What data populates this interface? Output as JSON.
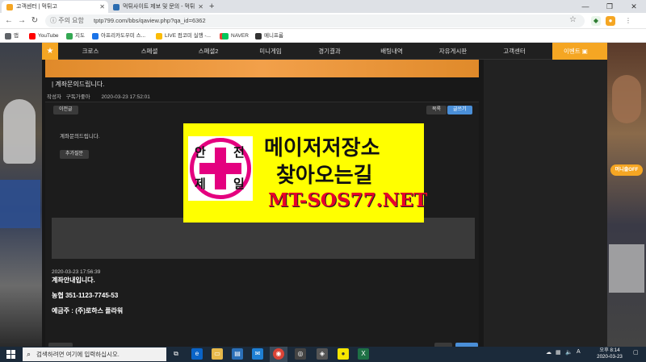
{
  "browser": {
    "tabs": [
      {
        "title": "고객센터 | 먹튀고",
        "active": true
      },
      {
        "title": "먹튀사이트 제보 및 문의 - 먹튀",
        "active": false
      }
    ],
    "address": {
      "info_text": "주의 요함",
      "url": "tptp799.com/bbs/qaview.php?qa_id=6362"
    },
    "bookmarks": [
      {
        "label": "앱",
        "color": "#5f6368"
      },
      {
        "label": "YouTube",
        "color": "#ff0000"
      },
      {
        "label": "지도",
        "color": "#34a853"
      },
      {
        "label": "아프리카도우미 스...",
        "color": "#1a73e8"
      },
      {
        "label": "LIVE 컴코미 실행 -...",
        "color": "#fbbc05"
      },
      {
        "label": "",
        "color": "#ea4335"
      },
      {
        "label": "NAVER",
        "color": "#03c75a"
      },
      {
        "label": "메니프롬",
        "color": "#333333"
      }
    ]
  },
  "site": {
    "menu": [
      "크로스",
      "스페셜",
      "스페셜2",
      "미니게임",
      "경기결과",
      "배팅내역",
      "자유게시판",
      "고객센터"
    ],
    "event_label": "이벤트",
    "side_pill": "머니출OFF"
  },
  "post": {
    "title": "| 계좌문의드립니다.",
    "author_label": "작성자",
    "author": "구독가좋아",
    "date": "2020-03-23 17:52:01",
    "prev_button": "이전글",
    "list_button": "목록",
    "write_button": "글쓰기",
    "body": "계좌문의드립니다.",
    "followup_button": "추가질문"
  },
  "answer": {
    "date": "2020-03-23 17:56:39",
    "lines": [
      "계좌안내입니다.",
      "농협  351-1123-7745-53",
      "예금주 : (주)로하스 플라워"
    ]
  },
  "ad": {
    "logo_chars": [
      "안",
      "전",
      "제",
      "일"
    ],
    "line1": "메이저저장소",
    "line2": "찾아오는길",
    "url": "MT-SOS77.NET",
    "colors": {
      "background": "#ffff00",
      "accent": "#e4007f",
      "url": "#e8002a"
    }
  },
  "taskbar": {
    "search_placeholder": "검색하려면 여기에 입력하십시오.",
    "time": "오후 8:14",
    "date": "2020-03-23"
  }
}
